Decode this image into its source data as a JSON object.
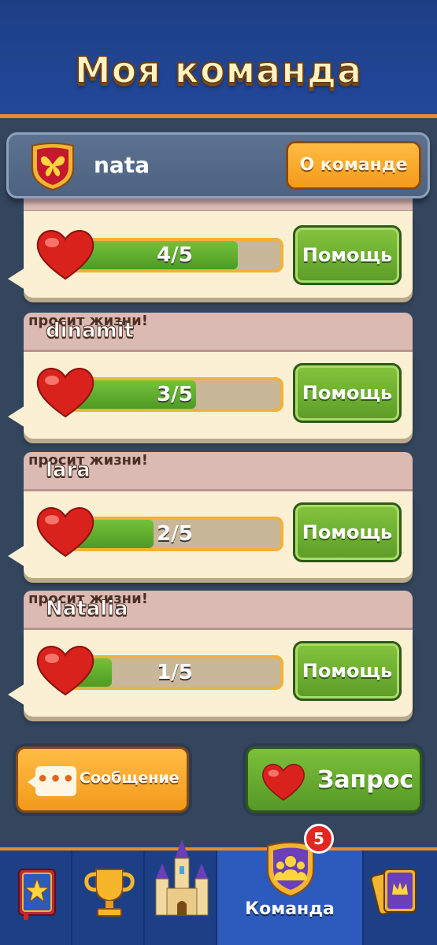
{
  "header": {
    "title": "Моя команда"
  },
  "team": {
    "name": "nata",
    "about_label": "О команде"
  },
  "cards": [
    {
      "player": "",
      "request_text": "",
      "lives": "4/5",
      "progress": 0.8,
      "help_label": "Помощь"
    },
    {
      "player": "dinamit",
      "request_text": "просит жизни!",
      "lives": "3/5",
      "progress": 0.6,
      "help_label": "Помощь"
    },
    {
      "player": "lara",
      "request_text": "просит жизни!",
      "lives": "2/5",
      "progress": 0.4,
      "help_label": "Помощь"
    },
    {
      "player": "Natalia",
      "request_text": "просит жизни!",
      "lives": "1/5",
      "progress": 0.2,
      "help_label": "Помощь"
    }
  ],
  "actions": {
    "message_label": "Сообщение",
    "request_label": "Запрос"
  },
  "nav": {
    "items": [
      {
        "icon": "star-book-icon",
        "label": ""
      },
      {
        "icon": "trophy-icon",
        "label": ""
      },
      {
        "icon": "castle-icon",
        "label": ""
      },
      {
        "icon": "team-shield-icon",
        "label": "Команда",
        "active": true,
        "badge": "5"
      },
      {
        "icon": "cards-icon",
        "label": ""
      }
    ]
  },
  "colors": {
    "accent_orange": "#f39a1b",
    "accent_green": "#5c9c27",
    "header_blue": "#1d3f86"
  }
}
